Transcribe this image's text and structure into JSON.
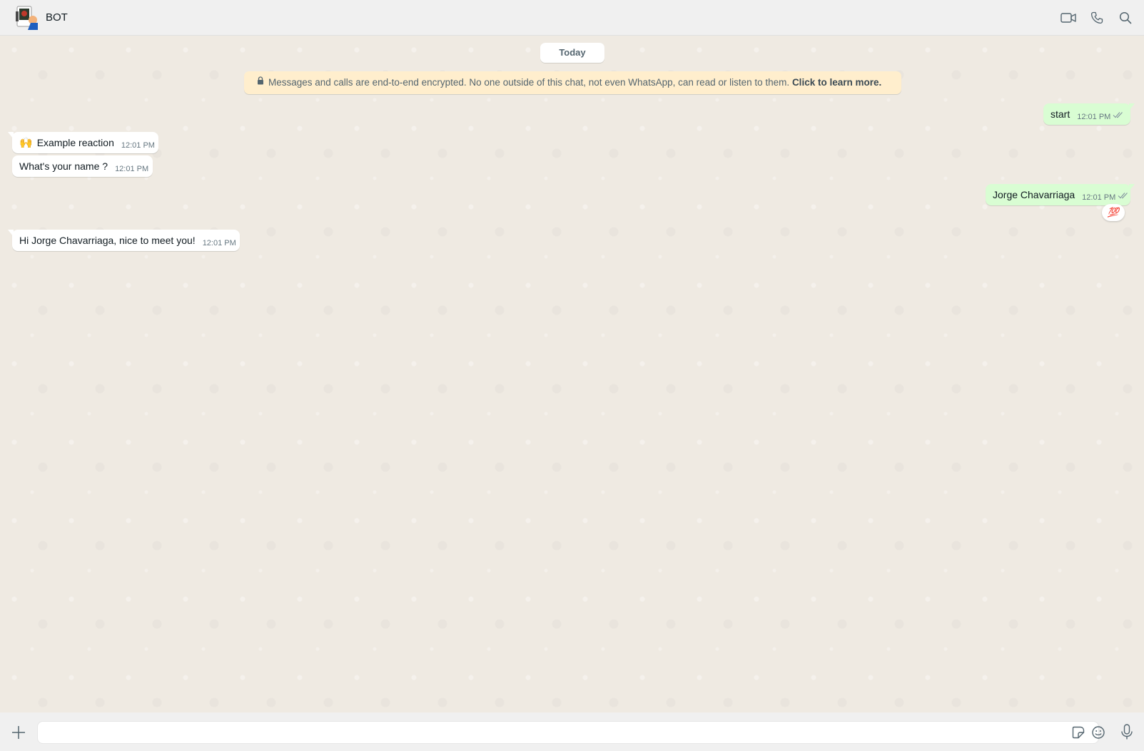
{
  "header": {
    "title": "BOT",
    "icons": [
      "video-call-icon",
      "voice-call-icon",
      "search-icon"
    ]
  },
  "chat": {
    "date_chip": "Today",
    "encryption_notice": {
      "text": "Messages and calls are end-to-end encrypted. No one outside of this chat, not even WhatsApp, can read or listen to them.",
      "link": "Click to learn more."
    },
    "messages": [
      {
        "direction": "out",
        "text": "start",
        "time": "12:01 PM",
        "status": "read"
      },
      {
        "direction": "in",
        "emoji": "🙌",
        "text": "Example reaction",
        "time": "12:01 PM"
      },
      {
        "direction": "in",
        "text": "What's your name ?",
        "time": "12:01 PM"
      },
      {
        "direction": "out",
        "text": "Jorge Chavarriaga",
        "time": "12:01 PM",
        "status": "read",
        "reaction": "💯"
      },
      {
        "direction": "in",
        "text": "Hi Jorge Chavarriaga, nice to meet you!",
        "time": "12:01 PM"
      }
    ]
  },
  "composer": {
    "value": "",
    "placeholder": "",
    "icons": [
      "plus-icon",
      "sticker-icon",
      "emoji-icon",
      "microphone-icon"
    ]
  },
  "colors": {
    "incoming_bubble": "#ffffff",
    "outgoing_bubble": "#d9fdd3",
    "chat_background": "#efeae2",
    "banner_background": "#ffeecd",
    "read_ticks": "#8696a0"
  }
}
